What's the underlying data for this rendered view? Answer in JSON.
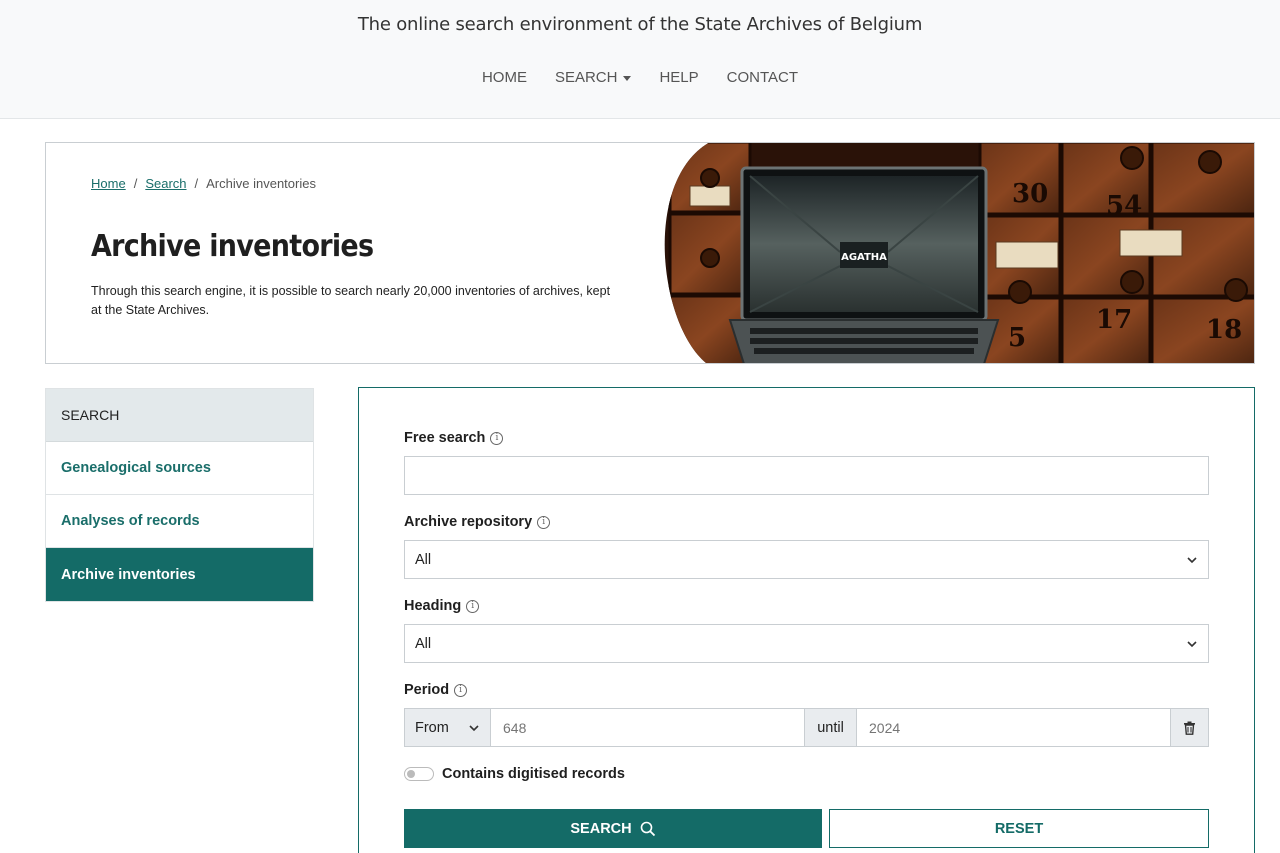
{
  "header": {
    "site_title": "The online search environment of the State Archives of Belgium",
    "nav": {
      "home": "HOME",
      "search": "SEARCH",
      "help": "HELP",
      "contact": "CONTACT"
    }
  },
  "hero": {
    "breadcrumb": {
      "home": "Home",
      "sep1": "/",
      "search": "Search",
      "sep2": "/",
      "current": "Archive inventories"
    },
    "title": "Archive inventories",
    "description": "Through this search engine, it is possible to search nearly 20,000 inventories of archives, kept at the State Archives.",
    "image_label": "AGATHA"
  },
  "sidebar": {
    "heading": "SEARCH",
    "items": [
      {
        "label": "Genealogical sources"
      },
      {
        "label": "Analyses of records"
      },
      {
        "label": "Archive inventories"
      }
    ]
  },
  "form": {
    "free_search": {
      "label": "Free search",
      "value": ""
    },
    "repository": {
      "label": "Archive repository",
      "selected": "All"
    },
    "heading": {
      "label": "Heading",
      "selected": "All"
    },
    "period": {
      "label": "Period",
      "mode": "From",
      "from_placeholder": "648",
      "until_label": "until",
      "until_placeholder": "2024"
    },
    "digitised": {
      "label": "Contains digitised records",
      "checked": false
    },
    "search_button": "SEARCH",
    "reset_button": "RESET"
  },
  "colors": {
    "accent": "#146b67",
    "header_bg": "#f8f9fa",
    "sidebar_head_bg": "#e3e9eb"
  },
  "icons": [
    "caret-down-icon",
    "info-icon",
    "chevron-down-icon",
    "trash-icon",
    "search-icon",
    "toggle-switch"
  ]
}
